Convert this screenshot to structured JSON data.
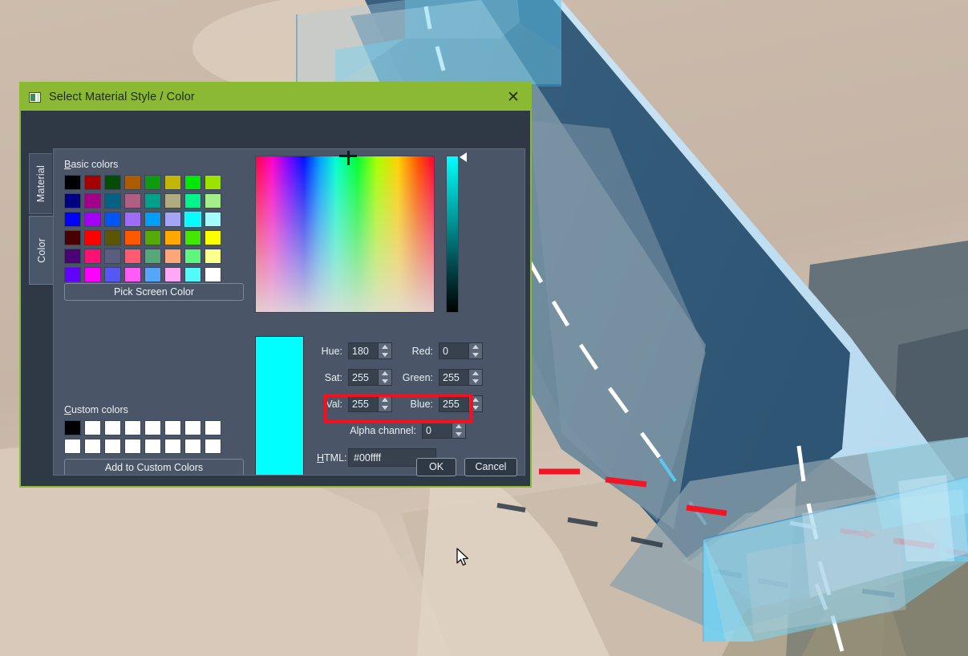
{
  "dialog": {
    "title": "Select Material Style / Color",
    "title_icon": "material-preview-icon",
    "close_icon": "close-icon",
    "accent_color": "#8cb933",
    "body_color": "#2f3845",
    "panel_color": "#4a5668"
  },
  "tabs": [
    {
      "label": "Material",
      "selected": false
    },
    {
      "label": "Color",
      "selected": true
    }
  ],
  "basic_colors": {
    "label": "Basic colors",
    "rows": [
      [
        "#000000",
        "#a30000",
        "#054d05",
        "#ad5c00",
        "#0f9b0f",
        "#c2b608",
        "#00e800",
        "#9ee300"
      ],
      [
        "#000080",
        "#a3008a",
        "#036283",
        "#b05e84",
        "#00a08a",
        "#b0ac81",
        "#00f48c",
        "#a4ef8c"
      ],
      [
        "#0000ff",
        "#a400f7",
        "#0055f7",
        "#a06bf5",
        "#009ff7",
        "#a5a5f7",
        "#00ffff",
        "#a3fcfc"
      ],
      [
        "#4a0000",
        "#ff0000",
        "#5c5603",
        "#ff5900",
        "#55ab05",
        "#ffa800",
        "#42e800",
        "#fdff00"
      ],
      [
        "#4b0076",
        "#ff1075",
        "#5b5d7f",
        "#ff5c73",
        "#56a877",
        "#ffa678",
        "#5ef77e",
        "#fdff8d"
      ],
      [
        "#6400ff",
        "#ff00ff",
        "#5757f7",
        "#ff5cf7",
        "#55a5fb",
        "#ffa7f7",
        "#52fafa",
        "#ffffff"
      ]
    ],
    "selected_index": {
      "row": 2,
      "col": 6
    }
  },
  "custom_colors": {
    "label": "Custom colors",
    "rows": [
      [
        "#000000",
        "#ffffff",
        "#ffffff",
        "#ffffff",
        "#ffffff",
        "#ffffff",
        "#ffffff",
        "#ffffff"
      ],
      [
        "#ffffff",
        "#ffffff",
        "#ffffff",
        "#ffffff",
        "#ffffff",
        "#ffffff",
        "#ffffff",
        "#ffffff"
      ]
    ]
  },
  "buttons": {
    "pick_screen_color": "Pick Screen Color",
    "add_to_custom_colors": "Add to Custom Colors",
    "ok": "OK",
    "cancel": "Cancel"
  },
  "fields": {
    "hue": {
      "label": "Hue:",
      "value": "180"
    },
    "sat": {
      "label": "Sat:",
      "value": "255"
    },
    "val": {
      "label": "Val:",
      "value": "255"
    },
    "red": {
      "label": "Red:",
      "value": "0"
    },
    "green": {
      "label": "Green:",
      "value": "255"
    },
    "blue": {
      "label": "Blue:",
      "value": "255"
    },
    "alpha": {
      "label": "Alpha channel:",
      "value": "0"
    },
    "html": {
      "label": "HTML:",
      "value": "#00ffff"
    }
  },
  "preview": {
    "color": "#00ffff"
  },
  "annotation": {
    "target": "alpha-channel-row",
    "color": "#fc0d1b"
  },
  "scene": {
    "description": "3D road intersection viewport with transparent cyan volumes",
    "ground_color": "#c9b8a8",
    "road_color": "#6f8c9e",
    "volume_color": "#7fd6f2"
  }
}
